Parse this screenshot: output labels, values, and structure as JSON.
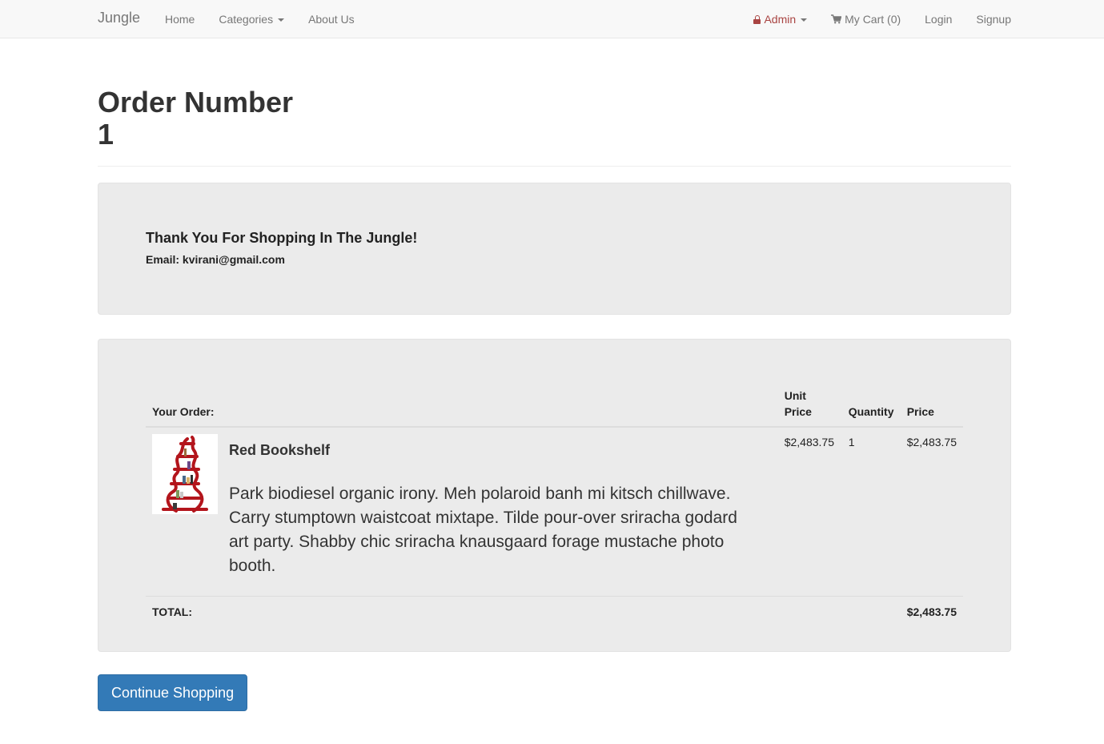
{
  "navbar": {
    "brand": "Jungle",
    "left_links": [
      "Home",
      "Categories",
      "About Us"
    ],
    "admin_label": "Admin",
    "cart_label": "My Cart (0)",
    "login_label": "Login",
    "signup_label": "Signup"
  },
  "page": {
    "title_line1": "Order Number",
    "title_line2": "1"
  },
  "thanks": {
    "heading": "Thank You For Shopping In The Jungle!",
    "email": "Email: kvirani@gmail.com"
  },
  "order": {
    "columns": {
      "item": "Your Order:",
      "unit_price_line1": "Unit",
      "unit_price_line2": "Price",
      "quantity": "Quantity",
      "price": "Price"
    },
    "items": [
      {
        "name": "Red Bookshelf",
        "description": "Park biodiesel organic irony. Meh polaroid banh mi kitsch chillwave. Carry stumptown waistcoat mixtape. Tilde pour-over sriracha godard art party. Shabby chic sriracha knausgaard forage mustache photo booth.",
        "unit_price": "$2,483.75",
        "quantity": "1",
        "price": "$2,483.75"
      }
    ],
    "total_label": "TOTAL:",
    "total_value": "$2,483.75"
  },
  "actions": {
    "continue_label": "Continue Shopping"
  },
  "colors": {
    "primary": "#337ab7",
    "admin": "#a94442",
    "well": "#ebebeb"
  }
}
